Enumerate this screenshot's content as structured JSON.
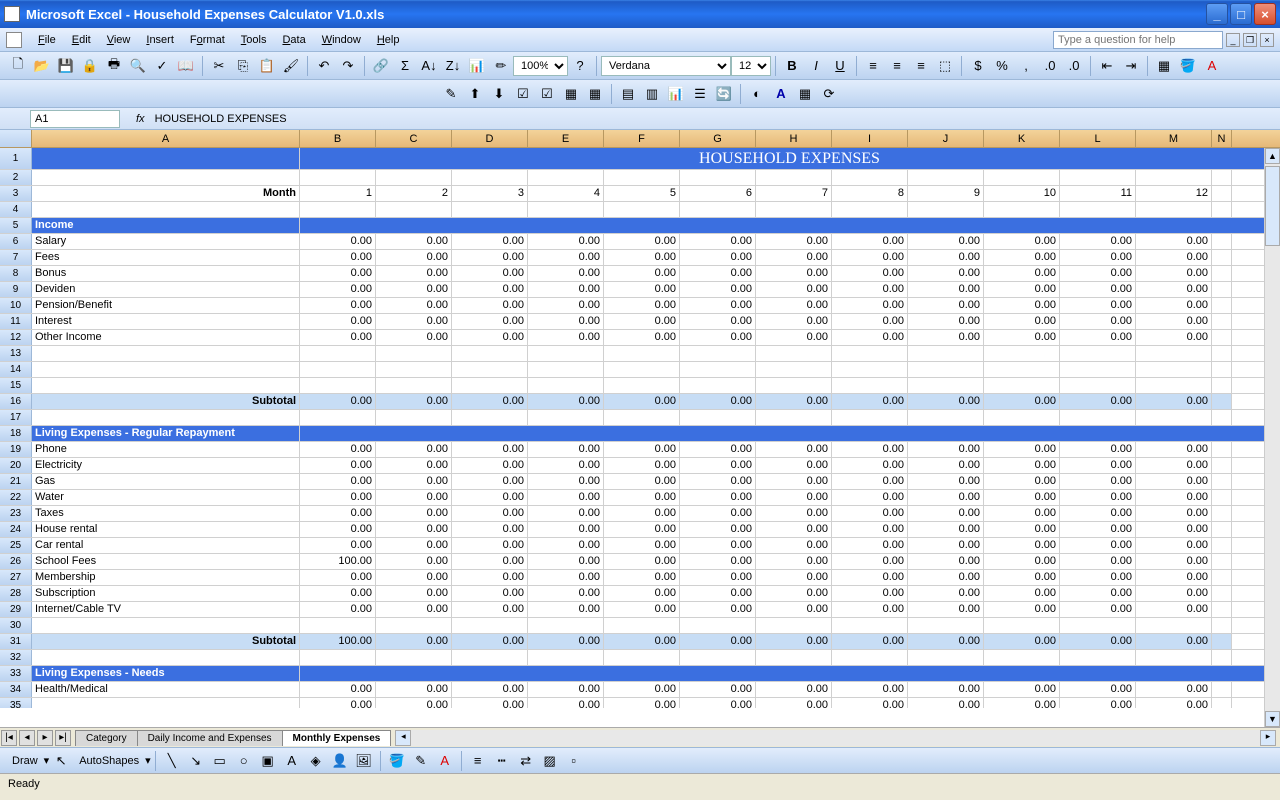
{
  "title": "Microsoft Excel - Household Expenses Calculator V1.0.xls",
  "menu": [
    "File",
    "Edit",
    "View",
    "Insert",
    "Format",
    "Tools",
    "Data",
    "Window",
    "Help"
  ],
  "helpPlaceholder": "Type a question for help",
  "font": {
    "name": "Verdana",
    "size": "12"
  },
  "zoom": "100%",
  "nameBox": "A1",
  "formulaValue": "HOUSEHOLD EXPENSES",
  "columns": [
    "A",
    "B",
    "C",
    "D",
    "E",
    "F",
    "G",
    "H",
    "I",
    "J",
    "K",
    "L",
    "M",
    "N"
  ],
  "bannerTitle": "HOUSEHOLD EXPENSES",
  "monthLabel": "Month",
  "months": [
    "1",
    "2",
    "3",
    "4",
    "5",
    "6",
    "7",
    "8",
    "9",
    "10",
    "11",
    "12"
  ],
  "subtotalLabel": "Subtotal",
  "sections": {
    "income": {
      "title": "Income",
      "items": [
        "Salary",
        "Fees",
        "Bonus",
        "Deviden",
        "Pension/Benefit",
        "Interest",
        "Other Income"
      ],
      "subtotal": [
        "0.00",
        "0.00",
        "0.00",
        "0.00",
        "0.00",
        "0.00",
        "0.00",
        "0.00",
        "0.00",
        "0.00",
        "0.00",
        "0.00"
      ]
    },
    "expReg": {
      "title": "Living Expenses - Regular Repayment",
      "items": [
        "Phone",
        "Electricity",
        "Gas",
        "Water",
        "Taxes",
        "House rental",
        "Car rental",
        "School Fees",
        "Membership",
        "Subscription",
        "Internet/Cable TV"
      ],
      "values": {
        "School Fees": "100.00"
      },
      "subtotal": [
        "100.00",
        "0.00",
        "0.00",
        "0.00",
        "0.00",
        "0.00",
        "0.00",
        "0.00",
        "0.00",
        "0.00",
        "0.00",
        "0.00"
      ]
    },
    "expNeeds": {
      "title": "Living Expenses - Needs",
      "items": [
        "Health/Medical"
      ]
    }
  },
  "zero": "0.00",
  "tabs": {
    "list": [
      "Category",
      "Daily Income and Expenses",
      "Monthly Expenses"
    ],
    "active": 2
  },
  "draw": {
    "label": "Draw",
    "autoshapes": "AutoShapes"
  },
  "status": "Ready"
}
